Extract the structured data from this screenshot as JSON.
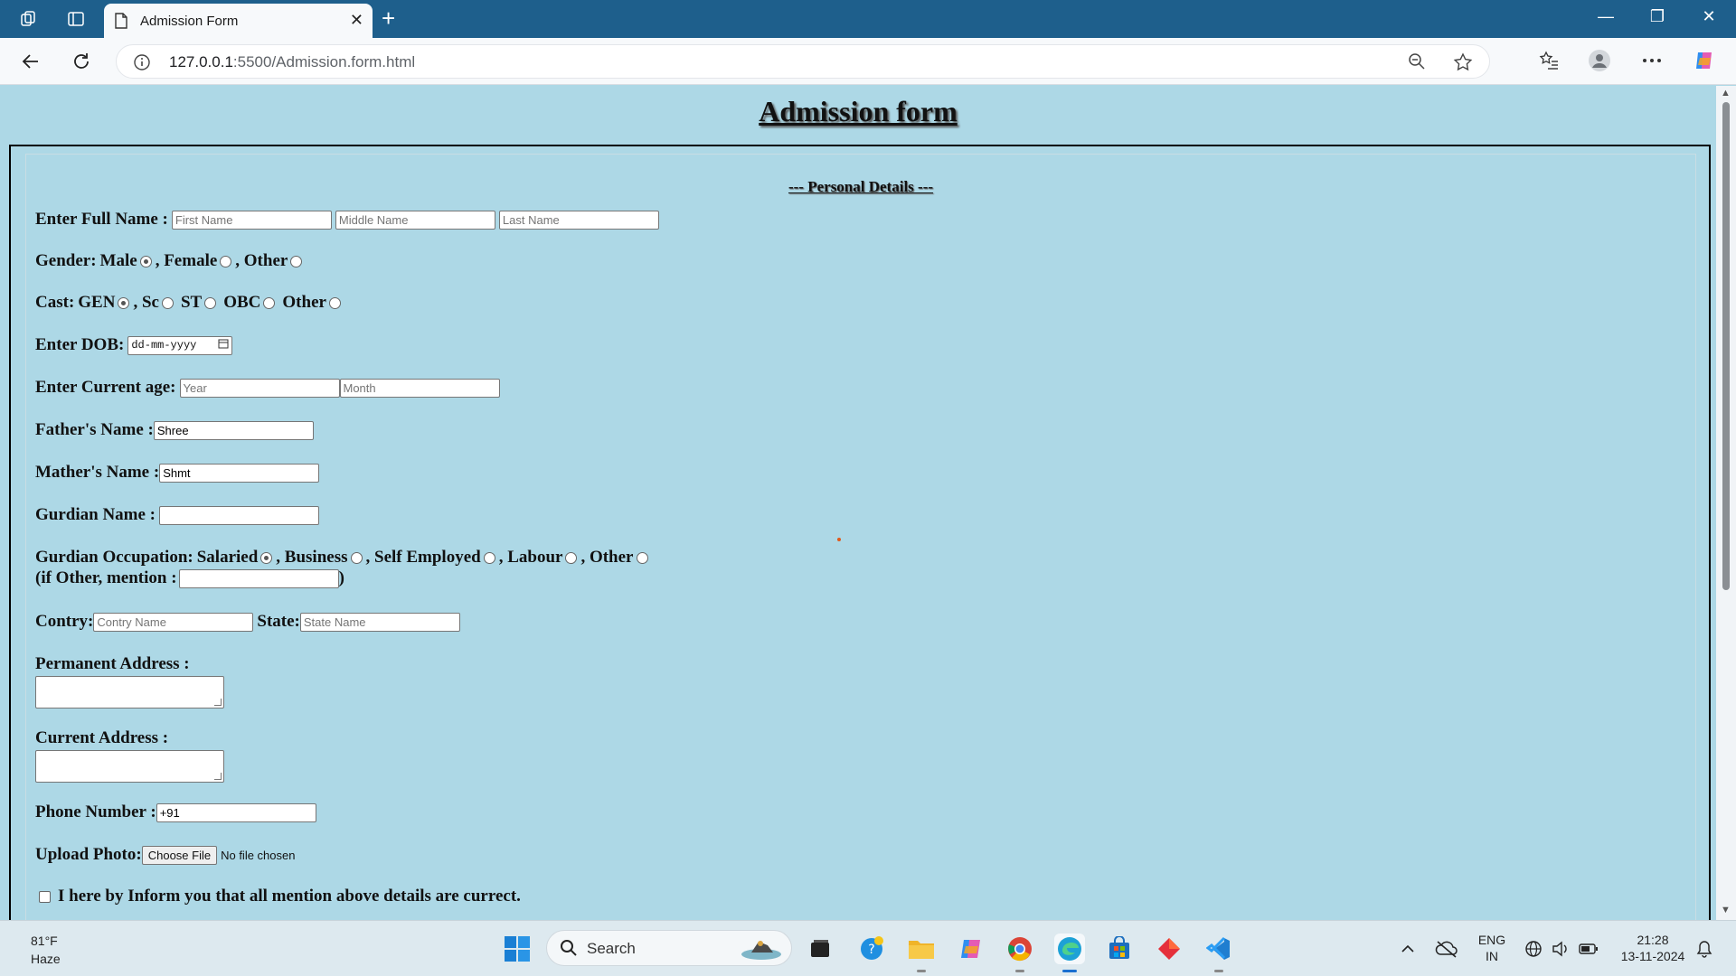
{
  "browser": {
    "tab_title": "Admission Form",
    "url_host": "127.0.0.1",
    "url_rest": ":5500/Admission.form.html"
  },
  "page": {
    "title": "Admission form",
    "legend": "--- Personal Details ---",
    "full_name": {
      "label": "Enter Full Name :",
      "first_placeholder": "First Name",
      "middle_placeholder": "Middle Name",
      "last_placeholder": "Last Name"
    },
    "gender": {
      "label": "Gender:",
      "options": [
        "Male",
        ", Female",
        ", Other"
      ],
      "selected": "Male"
    },
    "cast": {
      "label": "Cast:",
      "options": [
        "GEN",
        ", Sc",
        "ST",
        "OBC",
        "Other"
      ],
      "selected": "GEN"
    },
    "dob": {
      "label": "Enter DOB:",
      "placeholder": "dd-mm-yyyy"
    },
    "age": {
      "label": "Enter Current age:",
      "year_placeholder": "Year",
      "month_placeholder": "Month"
    },
    "father": {
      "label": "Father's Name :",
      "value": "Shree"
    },
    "mother": {
      "label": "Mather's Name :",
      "value": "Shmt"
    },
    "guardian": {
      "label": "Gurdian Name :",
      "value": ""
    },
    "occupation": {
      "label": "Gurdian Occupation:",
      "options": [
        "Salaried",
        ", Business",
        ", Self Employed",
        ", Labour",
        ", Other"
      ],
      "selected": "Salaried",
      "other_label": "(if Other, mention :",
      "other_close": ")"
    },
    "country": {
      "label": "Contry:",
      "placeholder": "Contry Name"
    },
    "state": {
      "label": "State:",
      "placeholder": "State Name"
    },
    "permanent_address": {
      "label": "Permanent Address :"
    },
    "current_address": {
      "label": "Current Address :"
    },
    "phone": {
      "label": "Phone Number :",
      "value": "+91"
    },
    "photo": {
      "label": "Upload Photo:",
      "button": "Choose File",
      "status": "No file chosen"
    },
    "declaration": "I here by Inform you that all mention above details are currect."
  },
  "taskbar": {
    "temperature": "81°F",
    "weather": "Haze",
    "search_placeholder": "Search",
    "lang_line1": "ENG",
    "lang_line2": "IN",
    "time": "21:28",
    "date": "13-11-2024"
  }
}
